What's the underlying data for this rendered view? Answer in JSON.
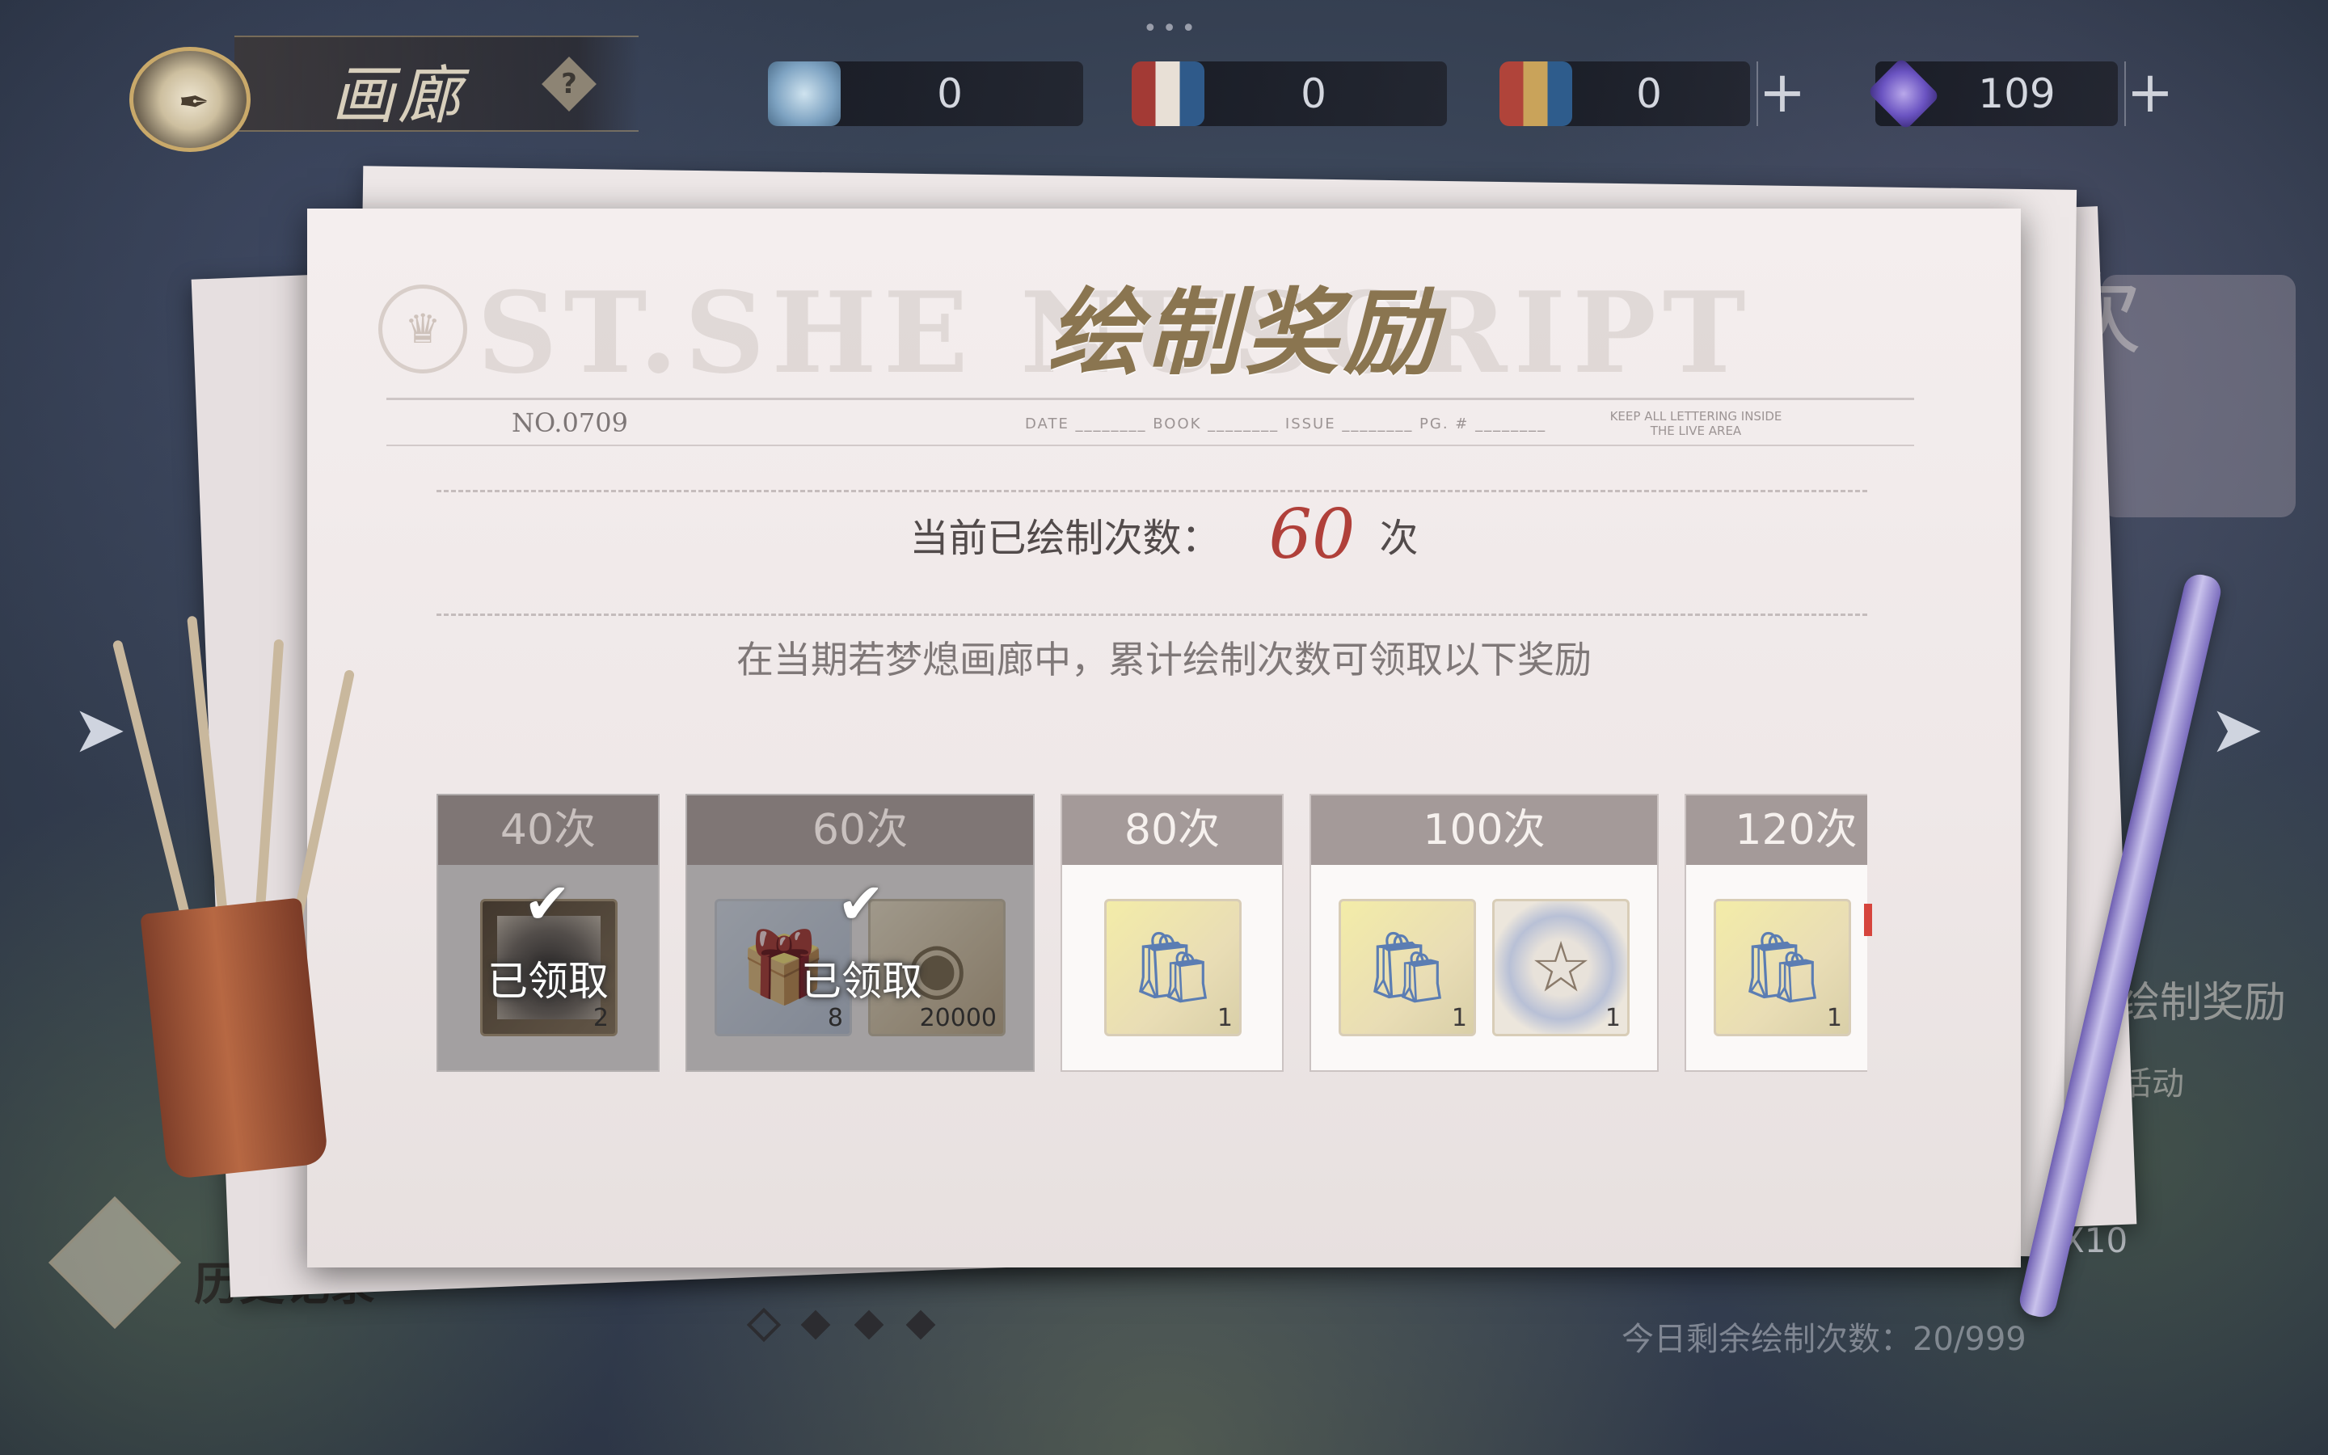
{
  "header": {
    "title": "画廊",
    "help_icon": "question-icon",
    "currencies": [
      {
        "icon": "crystal-icon",
        "value": "0",
        "has_plus": false
      },
      {
        "icon": "ink-bottles-icon",
        "value": "0",
        "has_plus": false
      },
      {
        "icon": "ink-bottles-gold-icon",
        "value": "0",
        "has_plus": true
      },
      {
        "icon": "diamond-icon",
        "value": "109",
        "has_plus": true
      }
    ],
    "plus_label": "+"
  },
  "panel": {
    "watermark": "ST.SHE  NUSCRIPT",
    "title": "绘制奖励",
    "header_no": "NO.0709",
    "header_fields": "DATE ________ BOOK ________ ISSUE ________ PG. # ________",
    "header_keep": "KEEP ALL LETTERING INSIDE THE LIVE AREA",
    "count_label": "当前已绘制次数：",
    "count_value": "60",
    "count_unit": "次",
    "description": "在当期若梦熄画廊中，累计绘制次数可领取以下奖励"
  },
  "rewards": [
    {
      "label": "40次",
      "claimed": true,
      "items": [
        {
          "type": "photo",
          "qty": "2"
        }
      ]
    },
    {
      "label": "60次",
      "claimed": true,
      "items": [
        {
          "type": "gift",
          "qty": "8"
        },
        {
          "type": "coins",
          "qty": "20000"
        }
      ]
    },
    {
      "label": "80次",
      "claimed": false,
      "items": [
        {
          "type": "bag",
          "qty": "1"
        }
      ]
    },
    {
      "label": "100次",
      "claimed": false,
      "items": [
        {
          "type": "bag",
          "qty": "1"
        },
        {
          "type": "wreath",
          "qty": "1"
        }
      ]
    },
    {
      "label": "120次",
      "claimed": false,
      "items": [
        {
          "type": "bag",
          "qty": "1"
        }
      ]
    }
  ],
  "claimed_label": "已领取",
  "side": {
    "history_label": "历史记录",
    "draw_reward_label": "绘制奖励",
    "event_label": "得活动",
    "draw_times_label": "次",
    "x10_label": "X10",
    "today_remaining": "今日剩余绘制次数：20/999"
  },
  "pagination": {
    "total": 4,
    "active": 0
  },
  "colors": {
    "accent_red": "#b0403a",
    "title_gold": "#8a7550"
  }
}
